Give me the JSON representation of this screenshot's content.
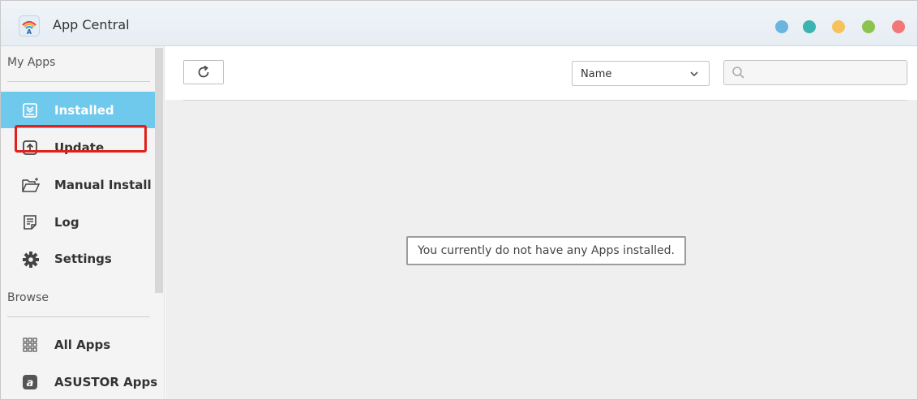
{
  "titlebar": {
    "title": "App Central",
    "logo_icon": "app-central-logo-icon",
    "window_dots": [
      {
        "name": "window-dot-blue",
        "color": "#6ab4e0"
      },
      {
        "name": "window-dot-teal",
        "color": "#3bb3b0"
      },
      {
        "name": "window-dot-yellow",
        "color": "#f7c25c"
      },
      {
        "name": "window-dot-green",
        "color": "#8cc34e"
      },
      {
        "name": "window-dot-red",
        "color": "#f27878"
      }
    ]
  },
  "sidebar": {
    "my_apps_label": "My Apps",
    "browse_label": "Browse",
    "items": [
      {
        "label": "Installed",
        "icon": "installed-icon",
        "active": true
      },
      {
        "label": "Update",
        "icon": "update-icon",
        "active": false
      },
      {
        "label": "Manual Install",
        "icon": "folder-open-icon",
        "active": false,
        "highlighted": true
      },
      {
        "label": "Log",
        "icon": "log-icon",
        "active": false
      },
      {
        "label": "Settings",
        "icon": "gear-icon",
        "active": false
      }
    ],
    "browse_items": [
      {
        "label": "All Apps",
        "icon": "grid-icon"
      },
      {
        "label": "ASUSTOR Apps",
        "icon": "asustor-apps-icon"
      }
    ]
  },
  "toolbar": {
    "refresh_icon": "refresh-icon",
    "sort_selected": "Name",
    "search_placeholder": "",
    "search_value": ""
  },
  "main": {
    "empty_message": "You currently do not have any Apps installed."
  },
  "colors": {
    "accent": "#6fc9ec",
    "highlight": "#e0201b"
  }
}
